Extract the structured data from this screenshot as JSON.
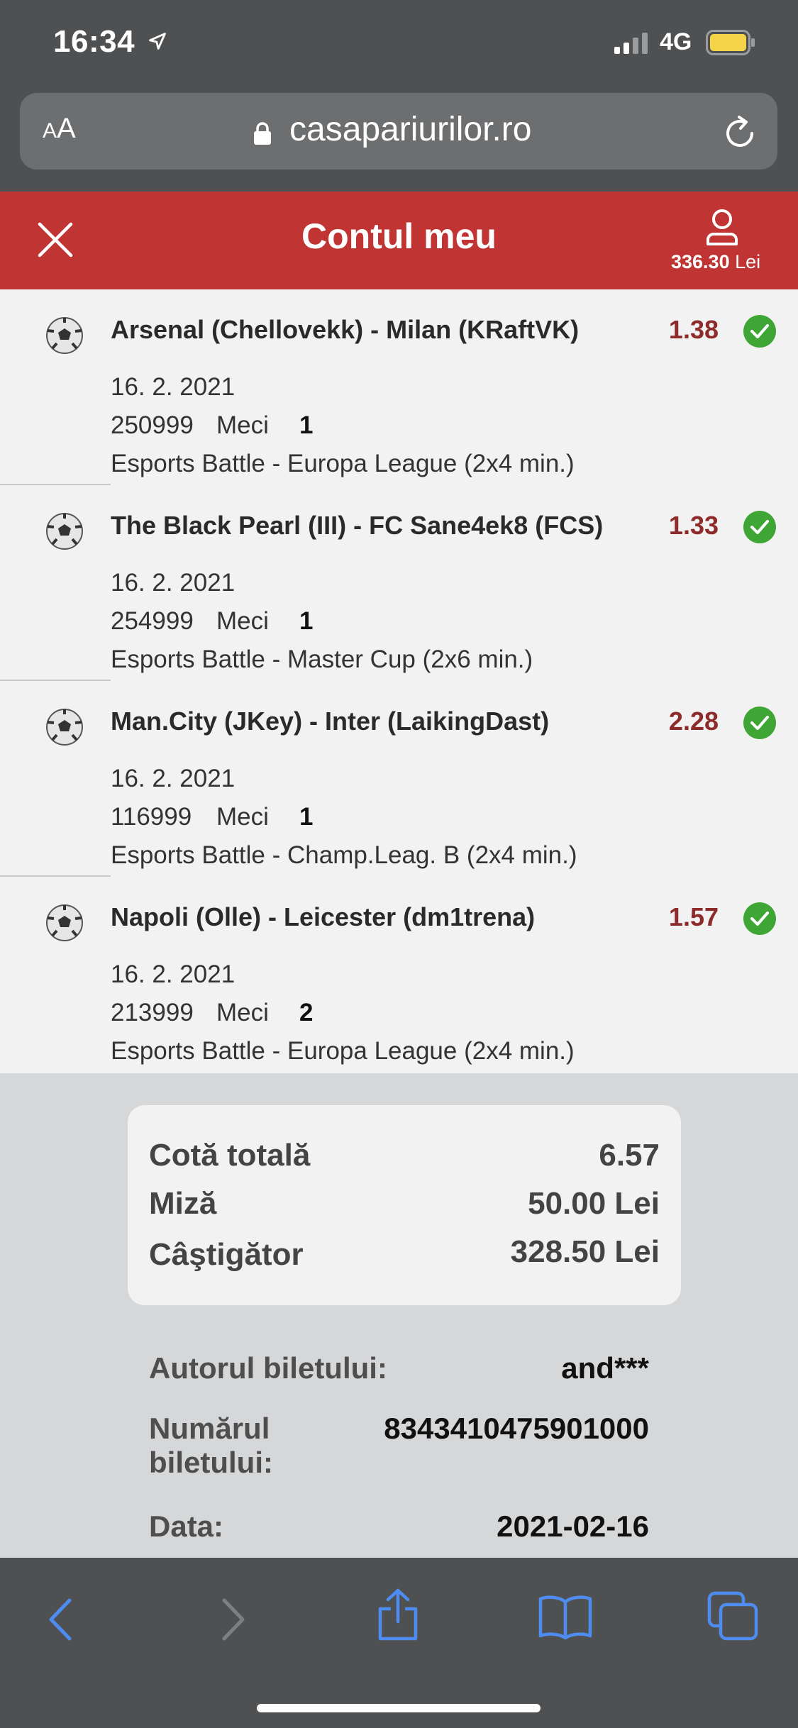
{
  "status": {
    "time": "16:34",
    "network": "4G"
  },
  "browser": {
    "text_size_label_small": "A",
    "text_size_label_large": "A",
    "url": "casapariurilor.ro"
  },
  "header": {
    "title": "Contul meu",
    "balance_amount": "336.30",
    "balance_currency": "Lei"
  },
  "bets": [
    {
      "match": "Arsenal (Chellovekk) - Milan (KRaftVK)",
      "odds": "1.38",
      "date": "16. 2. 2021",
      "code": "250999",
      "market": "Meci",
      "pick": "1",
      "league": "Esports Battle - Europa League (2x4 min.)",
      "status": "won"
    },
    {
      "match": "The Black Pearl (III) - FC Sane4ek8 (FCS)",
      "odds": "1.33",
      "date": "16. 2. 2021",
      "code": "254999",
      "market": "Meci",
      "pick": "1",
      "league": "Esports Battle - Master Cup (2x6 min.)",
      "status": "won"
    },
    {
      "match": "Man.City (JKey) - Inter (LaikingDast)",
      "odds": "2.28",
      "date": "16. 2. 2021",
      "code": "116999",
      "market": "Meci",
      "pick": "1",
      "league": "Esports Battle - Champ.Leag. B (2x4 min.)",
      "status": "won"
    },
    {
      "match": "Napoli (Olle) - Leicester (dm1trena)",
      "odds": "1.57",
      "date": "16. 2. 2021",
      "code": "213999",
      "market": "Meci",
      "pick": "2",
      "league": "Esports Battle - Europa League (2x4 min.)",
      "status": "won"
    }
  ],
  "summary": {
    "total_odds_label": "Cotă totală",
    "total_odds": "6.57",
    "stake_label": "Miză",
    "stake": "50.00 Lei",
    "winnings_label": "Câştigător",
    "winnings": "328.50 Lei"
  },
  "ticket": {
    "author_label": "Autorul biletului:",
    "author": "and***",
    "number_label_line1": "Numărul",
    "number_label_line2": "biletului:",
    "number": "8343410475901000",
    "date_label": "Data:",
    "date": "2021-02-16"
  },
  "colors": {
    "header_red": "#c03434",
    "odds_red": "#8d2a2a",
    "check_green": "#3fa535",
    "safari_blue": "#4f8cf2"
  },
  "icons": [
    "location-arrow-icon",
    "signal-icon",
    "battery-icon",
    "lock-icon",
    "reload-icon",
    "close-icon",
    "user-icon",
    "soccer-ball-icon",
    "check-circle-icon",
    "back-icon",
    "forward-icon",
    "share-icon",
    "bookmarks-icon",
    "tabs-icon"
  ]
}
